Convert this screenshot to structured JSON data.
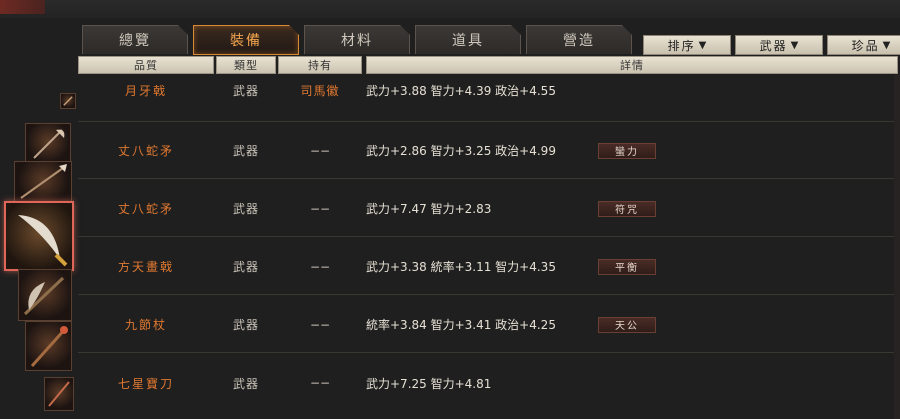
{
  "tabs": [
    {
      "label": "總覽",
      "active": false
    },
    {
      "label": "裝備",
      "active": true
    },
    {
      "label": "材料",
      "active": false
    },
    {
      "label": "道具",
      "active": false
    },
    {
      "label": "營造",
      "active": false
    }
  ],
  "filters": [
    {
      "label": "排序",
      "arrow": "▼"
    },
    {
      "label": "武器",
      "arrow": "▼"
    },
    {
      "label": "珍品",
      "arrow": "▼"
    }
  ],
  "columns": {
    "quality": "品質",
    "type": "類型",
    "owner": "持有",
    "detail": "詳情"
  },
  "rows": [
    {
      "name": "月牙戟",
      "type": "武器",
      "owner": "司馬徽",
      "detail": "武力+3.88  智力+4.39  政治+4.55",
      "tag": ""
    },
    {
      "name": "丈八蛇矛",
      "type": "武器",
      "owner": "−−",
      "detail": "武力+2.86  智力+3.25  政治+4.99",
      "tag": "蠻力"
    },
    {
      "name": "丈八蛇矛",
      "type": "武器",
      "owner": "−−",
      "detail": "武力+7.47  智力+2.83",
      "tag": "符咒"
    },
    {
      "name": "方天畫戟",
      "type": "武器",
      "owner": "−−",
      "detail": "武力+3.38  統率+3.11  智力+4.35",
      "tag": "平衡"
    },
    {
      "name": "九節杖",
      "type": "武器",
      "owner": "−−",
      "detail": "統率+3.84  智力+3.41  政治+4.25",
      "tag": "天公"
    },
    {
      "name": "七星寶刀",
      "type": "武器",
      "owner": "−−",
      "detail": "武力+7.25  智力+4.81",
      "tag": ""
    }
  ],
  "strip_icons": [
    "small-weapon-icon",
    "halberd-icon",
    "spear-icon",
    "crescent-blade-icon",
    "broad-blade-icon",
    "staff-icon",
    "small-blade-icon"
  ],
  "colors": {
    "accent": "#f1a34d",
    "name_orange": "#e07830",
    "selected_border": "#e0665a"
  }
}
